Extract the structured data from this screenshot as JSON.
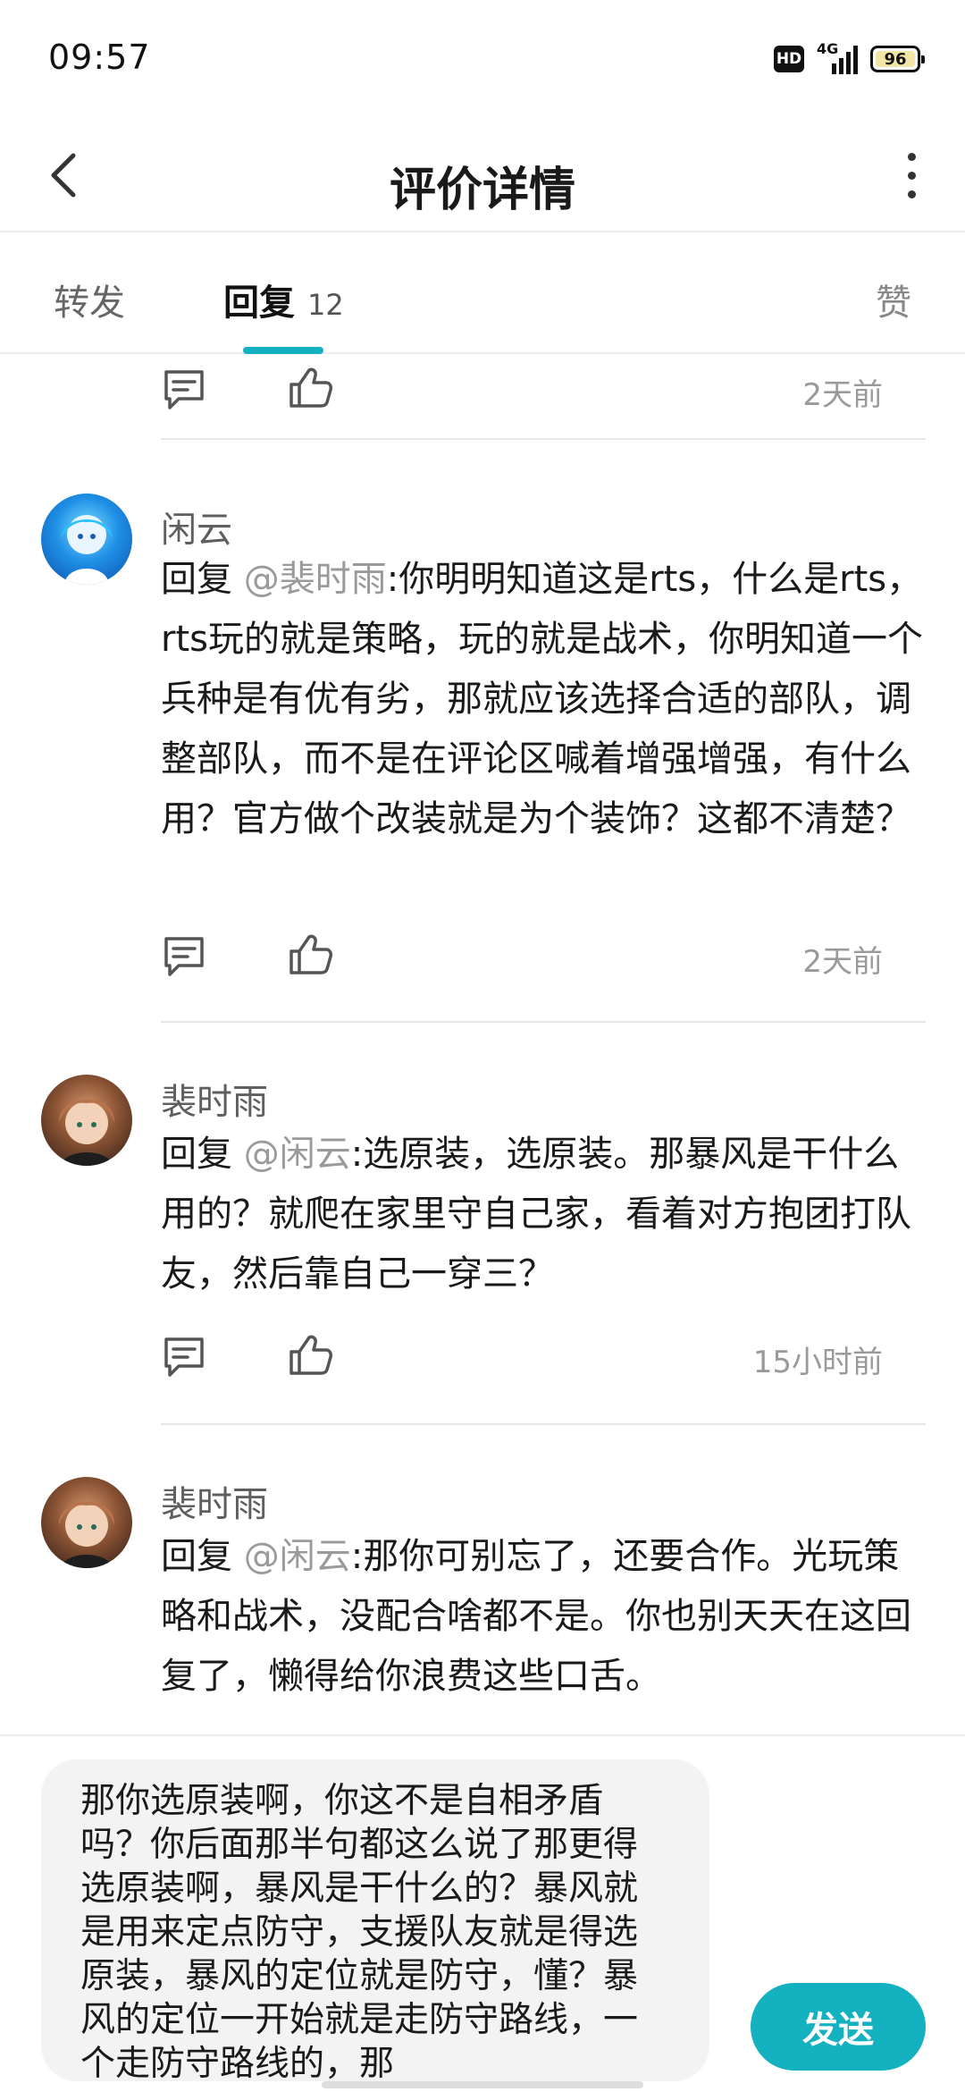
{
  "status_bar": {
    "time": "09:57",
    "hd": "HD",
    "network": "4G",
    "battery": "96"
  },
  "header": {
    "title": "评价详情"
  },
  "tabs": {
    "forward": "转发",
    "replies": "回复",
    "replies_count": "12",
    "likes": "赞"
  },
  "comments": [
    {
      "author": "闲云",
      "reply_prefix": "回复 ",
      "mention": "@裴时雨",
      "text": ":你明明知道这是rts，什么是rts，rts玩的就是策略，玩的就是战术，你明知道一个兵种是有优有劣，那就应该选择合适的部队，调整部队，而不是在评论区喊着增强增强，有什么用？官方做个改装就是为个装饰？这都不清楚？",
      "time": "2天前"
    },
    {
      "author": "裴时雨",
      "reply_prefix": "回复 ",
      "mention": "@闲云",
      "text": ":选原装，选原装。那暴风是干什么用的？就爬在家里守自己家，看着对方抱团打队友，然后靠自己一穿三？",
      "time": "15小时前"
    },
    {
      "author": "裴时雨",
      "reply_prefix": "回复 ",
      "mention": "@闲云",
      "text": ":那你可别忘了，还要合作。光玩策略和战术，没配合啥都不是。你也别天天在这回复了，懒得给你浪费这些口舌。"
    }
  ],
  "top_partial_time": "2天前",
  "reply_draft": "那你选原装啊，你这不是自相矛盾吗？你后面那半句都这么说了那更得选原装啊，暴风是干什么的？暴风就是用来定点防守，支援队友就是得选原装，暴风的定位就是防守，懂？暴风的定位一开始就是走防守路线，一个走防守路线的，那",
  "send_label": "发送",
  "colors": {
    "accent": "#14b2c0",
    "mention": "#9a9a9a",
    "time": "#9a9a9a"
  },
  "icons": [
    "back-arrow-icon",
    "more-vertical-icon",
    "comment-icon",
    "like-icon"
  ]
}
